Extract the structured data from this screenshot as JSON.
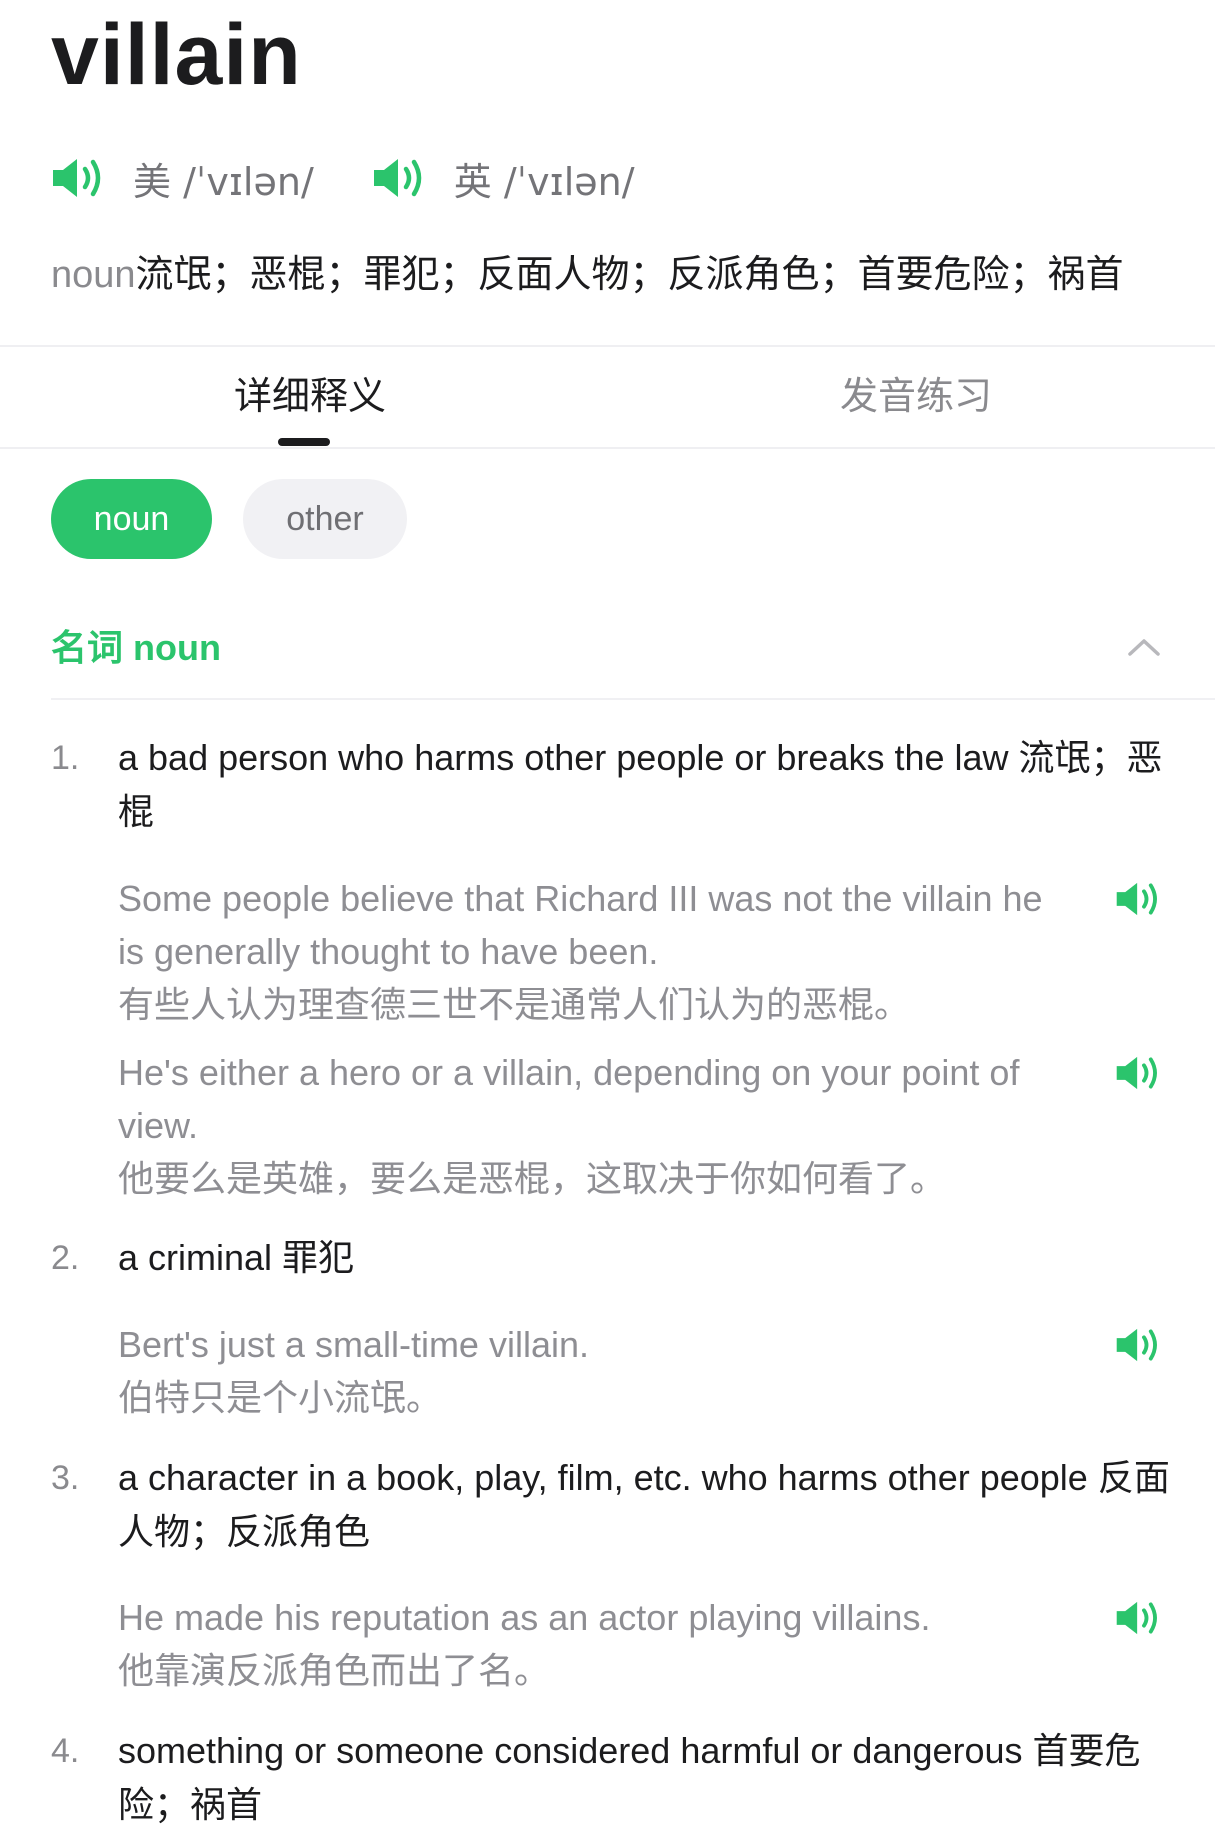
{
  "word": "villain",
  "phonetics": [
    {
      "label": "美 /ˈvɪlən/"
    },
    {
      "label": "英 /ˈvɪlən/"
    }
  ],
  "summary": {
    "pos": "noun",
    "meanings": "流氓；恶棍；罪犯；反面人物；反派角色；首要危险；祸首"
  },
  "tabs": [
    {
      "label": "详细释义",
      "active": true
    },
    {
      "label": "发音练习",
      "active": false
    }
  ],
  "pos_chips": [
    {
      "label": "noun",
      "active": true
    },
    {
      "label": "other",
      "active": false
    }
  ],
  "section": {
    "title": "名词 noun",
    "expanded": true
  },
  "senses": [
    {
      "number": "1.",
      "definition": "a bad person who harms other people or breaks the law 流氓；恶棍",
      "examples": [
        {
          "en": "Some people believe that Richard III was not the villain he is generally thought to have been.",
          "zh": "有些人认为理查德三世不是通常人们认为的恶棍。"
        },
        {
          "en": "He's either a hero or a villain, depending on your point of view.",
          "zh": "他要么是英雄，要么是恶棍，这取决于你如何看了。"
        }
      ]
    },
    {
      "number": "2.",
      "definition": "a criminal 罪犯",
      "examples": [
        {
          "en": "Bert's just a small-time villain.",
          "zh": "伯特只是个小流氓。"
        }
      ]
    },
    {
      "number": "3.",
      "definition": "a character in a book, play, film, etc. who harms other people 反面人物；反派角色",
      "examples": [
        {
          "en": "He made his reputation as an actor playing villains.",
          "zh": "他靠演反派角色而出了名。"
        }
      ]
    },
    {
      "number": "4.",
      "definition": "something or someone considered harmful or dangerous 首要危险；祸首",
      "examples": []
    }
  ],
  "icons": {
    "speaker": "speaker-volume-icon",
    "collapse": "chevron-up-icon"
  },
  "colors": {
    "accent": "#2bc46c",
    "text": "#1c1c1e",
    "secondary": "#8e8e93",
    "chip_bg": "#f1f1f4"
  }
}
